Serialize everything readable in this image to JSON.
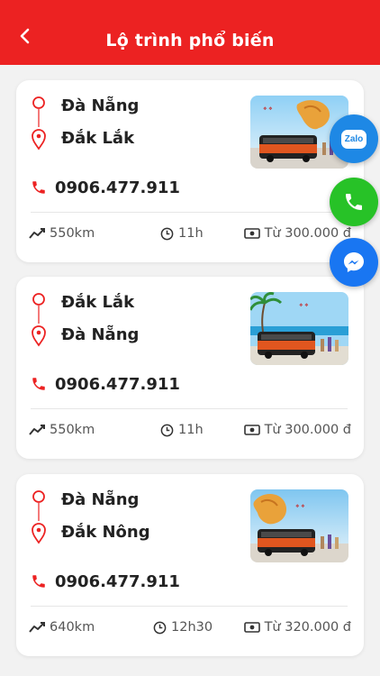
{
  "header": {
    "title": "Lộ trình phổ biến"
  },
  "routes": [
    {
      "from": "Đà Nẵng",
      "to": "Đắk Lắk",
      "phone": "0906.477.911",
      "distance": "550km",
      "duration": "11h",
      "price": "Từ 300.000 đ"
    },
    {
      "from": "Đắk Lắk",
      "to": "Đà Nẵng",
      "phone": "0906.477.911",
      "distance": "550km",
      "duration": "11h",
      "price": "Từ 300.000 đ"
    },
    {
      "from": "Đà Nẵng",
      "to": "Đắk Nông",
      "phone": "0906.477.911",
      "distance": "640km",
      "duration": "12h30",
      "price": "Từ 320.000 đ"
    }
  ],
  "floating": {
    "zalo_label": "Zalo"
  },
  "colors": {
    "primary": "#ec2222",
    "zalo": "#1e88e5",
    "call": "#27c227",
    "messenger": "#1976f2"
  }
}
